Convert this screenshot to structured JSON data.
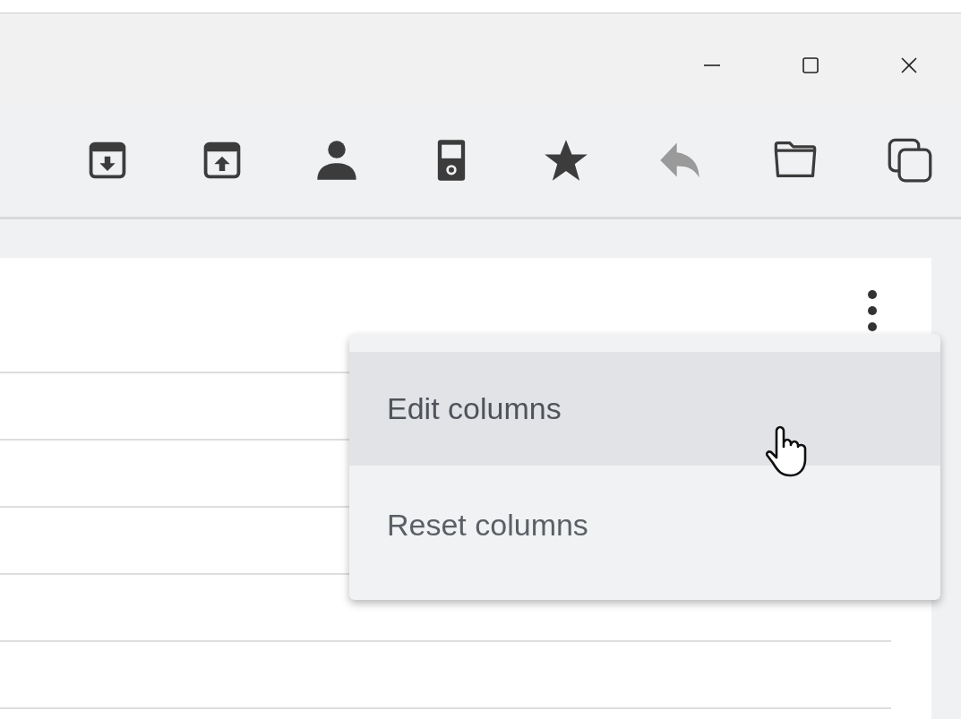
{
  "window_controls": [
    {
      "kind": "minimize"
    },
    {
      "kind": "maximize"
    },
    {
      "kind": "close"
    }
  ],
  "toolbar": [
    {
      "kind": "archive-down",
      "disabled": false
    },
    {
      "kind": "archive-up",
      "disabled": false
    },
    {
      "kind": "person",
      "disabled": false
    },
    {
      "kind": "device",
      "disabled": false
    },
    {
      "kind": "star",
      "disabled": false
    },
    {
      "kind": "reply",
      "disabled": true
    },
    {
      "kind": "folder",
      "disabled": false
    },
    {
      "kind": "copy",
      "disabled": false
    }
  ],
  "table_menu": {
    "items": [
      {
        "label": "Edit columns",
        "selected": true
      },
      {
        "label": "Reset columns",
        "selected": false
      }
    ]
  }
}
